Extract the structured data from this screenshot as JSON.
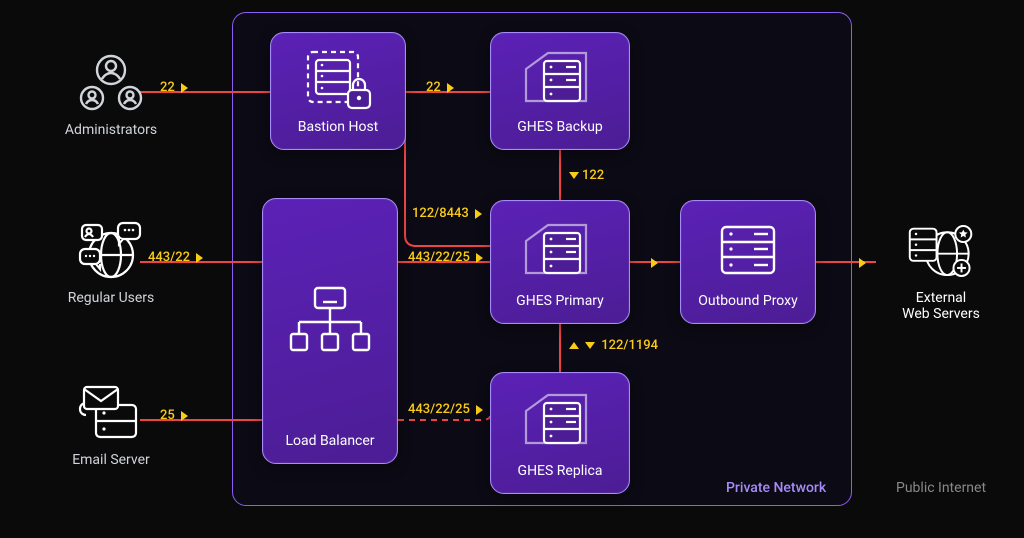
{
  "diagram": {
    "regions": {
      "private": "Private Network",
      "public": "Public Internet"
    },
    "actors": {
      "admins": "Administrators",
      "regular": "Regular Users",
      "email": "Email Server",
      "external": "External\nWeb Servers"
    },
    "nodes": {
      "bastion": "Bastion Host",
      "backup": "GHES Backup",
      "lb": "Load Balancer",
      "primary": "GHES Primary",
      "replica": "GHES Replica",
      "proxy": "Outbound Proxy"
    },
    "edges": {
      "admins_bastion": "22",
      "bastion_backup": "22",
      "backup_primary": "122",
      "bastion_primary": "122/8443",
      "regular_lb": "443/22",
      "lb_primary": "443/22/25",
      "primary_replica": "122/1194",
      "lb_replica": "443/22/25",
      "email_lb": "25"
    },
    "colors": {
      "connection": "#ef4444",
      "badge": "#facc15",
      "node_border": "#a78bfa"
    }
  }
}
